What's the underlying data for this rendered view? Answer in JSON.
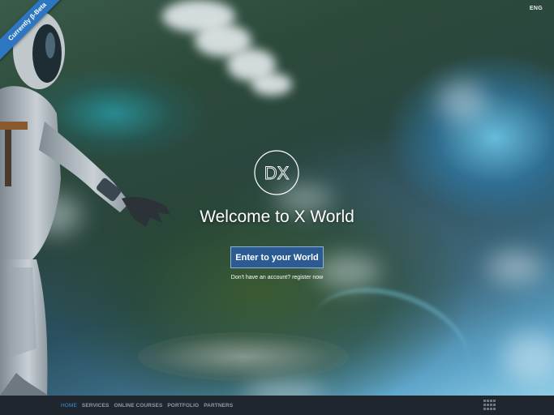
{
  "ribbon": {
    "label": "Currently β-Beta"
  },
  "language": {
    "code": "ENG"
  },
  "hero": {
    "logo_text": "DX",
    "title": "Welcome to X World",
    "enter_button": "Enter to your World",
    "register_text": "Don't have an account? register now"
  },
  "footer_nav": {
    "items": [
      {
        "label": "HOME",
        "active": true
      },
      {
        "label": "SERVICES",
        "active": false
      },
      {
        "label": "ONLINE COURSES",
        "active": false
      },
      {
        "label": "PORTFOLIO",
        "active": false
      },
      {
        "label": "PARTNERS",
        "active": false
      }
    ],
    "menu_icon": "grid-menu-icon"
  },
  "colors": {
    "ribbon": "#2d77c2",
    "button": "#2c5a92",
    "footer": "#1f262d",
    "nav_active": "#3e8fd6",
    "nav_inactive": "#8e9aa4"
  }
}
